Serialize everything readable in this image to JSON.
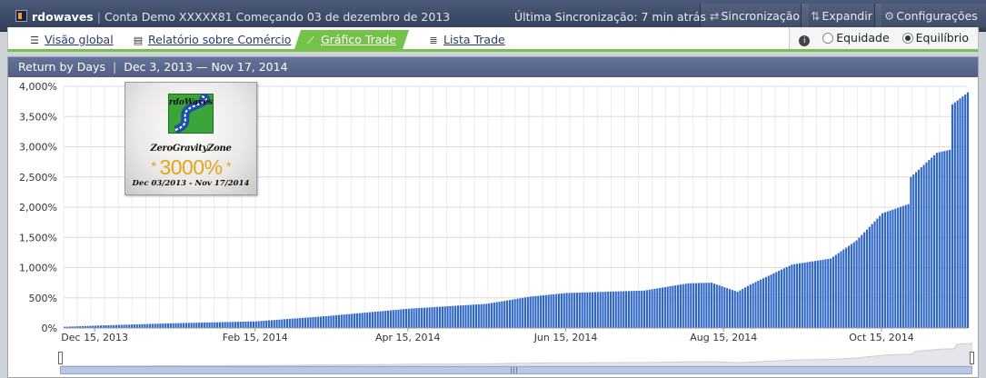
{
  "topbar": {
    "app_name": "rdowaves",
    "account": "Conta Demo XXXXX81 Começando 03 de dezembro de 2013",
    "last_sync": "Última Sincronização: 7 min atrás",
    "sync_label": "Sincronização",
    "expand_label": "Expandir",
    "settings_label": "Configurações"
  },
  "tabs": [
    {
      "label": "Visão global",
      "icon": "list-lines-icon",
      "active": false
    },
    {
      "label": "Relatório sobre Comércio",
      "icon": "report-list-icon",
      "active": false
    },
    {
      "label": "Gráfico Trade",
      "icon": "line-chart-icon",
      "active": true
    },
    {
      "label": "Lista Trade",
      "icon": "table-lines-icon",
      "active": false
    }
  ],
  "view_mode": {
    "options": [
      "Equidade",
      "Equilíbrio"
    ],
    "selected": "Equilíbrio"
  },
  "panel": {
    "title": "Return by Days",
    "date_range": "Dec 3, 2013 — Nov 17, 2014"
  },
  "logo": {
    "brand": "rdoWaves",
    "subtitle": "ZeroGravityZone",
    "headline": "3000%",
    "dates": "Dec 03/2013 - Nov 17/2014"
  },
  "colors": {
    "bar": "#2f67c6",
    "accent_green": "#74c24a",
    "header": "#3c4a68"
  },
  "chart_data": {
    "type": "bar",
    "y_unit": "%",
    "ylim": [
      0,
      4000
    ],
    "y_ticks": [
      "0%",
      "500%",
      "1,000%",
      "1,500%",
      "2,000%",
      "2,500%",
      "3,000%",
      "3,500%",
      "4,000%"
    ],
    "x_tick_labels": [
      "Dec 15, 2013",
      "Feb 15, 2014",
      "Apr 15, 2014",
      "Jun 15, 2014",
      "Aug 15, 2014",
      "Oct 15, 2014"
    ],
    "x_start": "2013-12-03",
    "x_end": "2014-11-17",
    "grid": true,
    "series": [
      {
        "x": [
          "2013-12-03",
          "2013-12-15",
          "2014-01-15",
          "2014-02-15",
          "2014-03-15",
          "2014-04-15",
          "2014-05-15",
          "2014-06-01",
          "2014-06-15",
          "2014-07-15",
          "2014-08-01",
          "2014-08-10",
          "2014-08-20",
          "2014-08-25",
          "2014-09-10",
          "2014-09-25",
          "2014-10-05",
          "2014-10-15",
          "2014-10-25",
          "2014-10-26",
          "2014-11-05",
          "2014-11-10",
          "2014-11-11",
          "2014-11-17"
        ],
        "y": [
          20,
          40,
          80,
          110,
          200,
          320,
          400,
          520,
          580,
          620,
          740,
          750,
          600,
          720,
          1050,
          1150,
          1450,
          1900,
          2050,
          2500,
          2900,
          2950,
          3700,
          3900
        ]
      }
    ]
  }
}
